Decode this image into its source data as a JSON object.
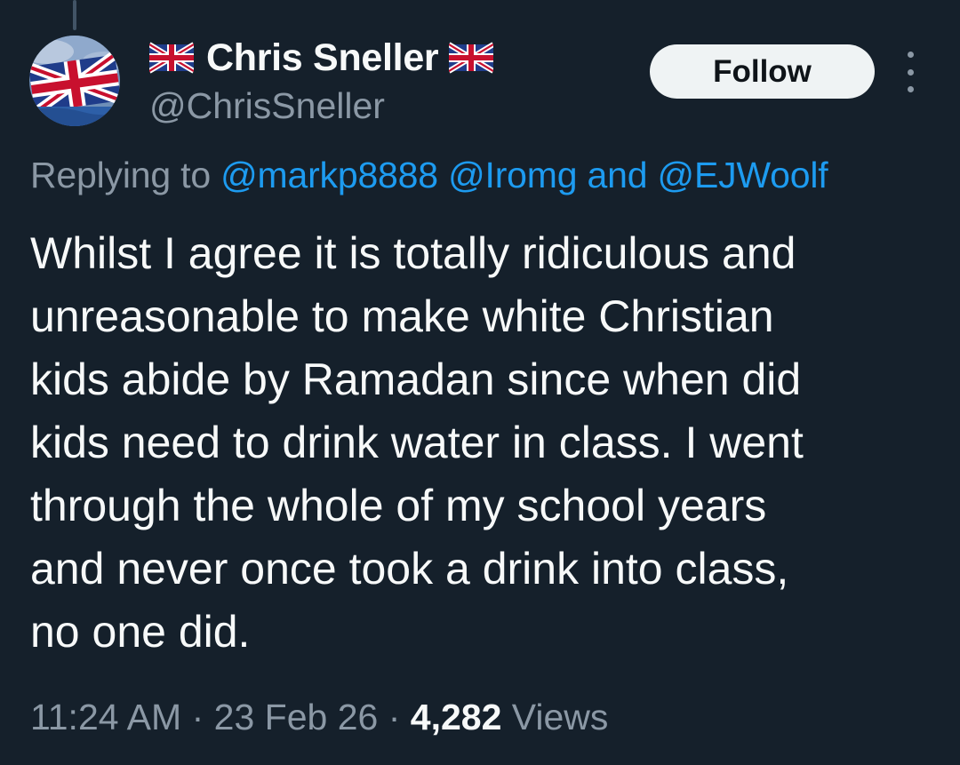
{
  "author": {
    "display_name": "Chris Sneller",
    "handle": "@ChrisSneller",
    "name_emoji": "uk-flag-icon",
    "avatar": "union-jack-flag-avatar"
  },
  "actions": {
    "follow_label": "Follow",
    "more_icon": "more-vertical-icon"
  },
  "reply": {
    "prefix": "Replying to",
    "mentions": [
      "@markp8888",
      "@Iromg"
    ],
    "conjunction": "and",
    "last_mention": "@EJWoolf"
  },
  "tweet": {
    "lines": [
      "Whilst I agree it is totally ridiculous and",
      "unreasonable to make white Christian",
      "kids abide by Ramadan since when did",
      "kids need to drink water in class. I went",
      "through the whole of my school years",
      "and never once took a drink into class,",
      "no one did."
    ]
  },
  "meta": {
    "time": "11:24 AM",
    "separator": "·",
    "date": "23 Feb 26",
    "views_count": "4,282",
    "views_label": "Views"
  },
  "colors": {
    "background": "#15202b",
    "text_primary": "#f7f9f9",
    "text_secondary": "#8b98a5",
    "link": "#1d9bf0",
    "follow_bg": "#eff3f4"
  }
}
